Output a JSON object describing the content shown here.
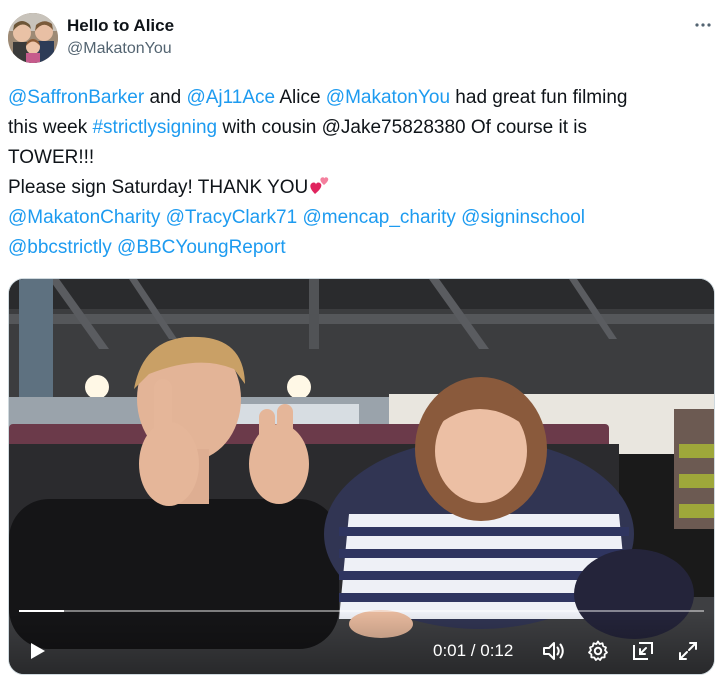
{
  "author": {
    "display_name": "Hello to Alice",
    "handle": "@MakatonYou"
  },
  "tweet": {
    "line1": [
      {
        "t": "@SaffronBarker",
        "kind": "mention"
      },
      {
        "t": " and ",
        "kind": "text"
      },
      {
        "t": "@Aj11Ace",
        "kind": "mention"
      },
      {
        "t": " Alice ",
        "kind": "text"
      },
      {
        "t": "@MakatonYou",
        "kind": "mention"
      },
      {
        "t": " had great fun filming",
        "kind": "text"
      }
    ],
    "line2_a": "this week ",
    "line2_hashtag": "#strictlysigning",
    "line2_b": " with cousin @Jake75828380 Of course it is",
    "line3": "TOWER!!!",
    "line4": "Please sign Saturday! THANK YOU",
    "line4_emoji": "two-hearts-emoji",
    "line5": [
      {
        "t": "@MakatonCharity",
        "kind": "mention"
      },
      {
        "t": " ",
        "kind": "text"
      },
      {
        "t": "@TracyClark71",
        "kind": "mention"
      },
      {
        "t": " ",
        "kind": "text"
      },
      {
        "t": "@mencap_charity",
        "kind": "mention"
      },
      {
        "t": " ",
        "kind": "text"
      },
      {
        "t": "@signinschool",
        "kind": "mention"
      }
    ],
    "line6": [
      {
        "t": "@bbcstrictly",
        "kind": "mention"
      },
      {
        "t": " ",
        "kind": "text"
      },
      {
        "t": "@BBCYoungReport",
        "kind": "mention"
      }
    ]
  },
  "video": {
    "time_display": "0:01 / 0:12",
    "progress_fraction": 0.065,
    "controls": [
      "play-icon",
      "volume-icon",
      "settings-gear-icon",
      "pip-icon",
      "fullscreen-icon"
    ]
  },
  "colors": {
    "link": "#1d9bf0",
    "text": "#0f1419",
    "secondary": "#536471"
  }
}
